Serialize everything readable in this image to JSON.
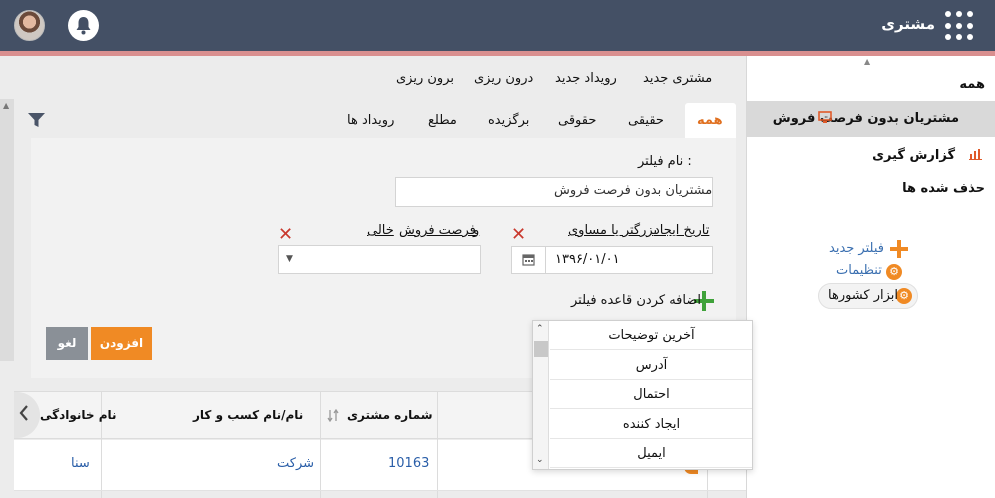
{
  "header": {
    "app_title": "مشتری"
  },
  "sidebar": {
    "items": {
      "all": "همه",
      "customers_no_opportunity": "مشتریان بدون فرصت فروش",
      "reporting": "گزارش گیری",
      "deleted": "حذف شده ها"
    },
    "links": {
      "new_filter": "فیلتر جدید",
      "settings": "تنظیمات",
      "country_tools": "ابزار کشورها"
    }
  },
  "top_menu": {
    "new_customer": "مشتری جدید",
    "new_event": "رویداد جدید",
    "import": "درون ریزی",
    "export": "برون ریزی"
  },
  "tabs": {
    "all": "همه",
    "legal": "حقیقی",
    "natural": "حقوقی",
    "selected": "برگزیده",
    "informed": "مطلع",
    "events": "رویداد ها"
  },
  "filter": {
    "name_label": "نام فیلتر :",
    "name_value": "مشتریان بدون فرصت فروش",
    "rule1": {
      "field": "تاریخ ایجاد",
      "operator": "بزرگتر یا مساوی",
      "value": "۱۳۹۶/۰۱/۰۱"
    },
    "connector": "و",
    "rule2": {
      "field": "فرصت فروش",
      "operator": "خالی",
      "value": ""
    },
    "add_rule": "اضافه کردن قاعده فیلتر",
    "add_button": "افزودن",
    "cancel_button": "لغو"
  },
  "dropdown_options": [
    "آخرین توضیحات",
    "آدرس",
    "احتمال",
    "ایجاد کننده",
    "ایمیل"
  ],
  "grid": {
    "headers": {
      "customer_number": "شماره مشتری",
      "business_name": "نام/نام کسب و کار",
      "family_name": "نام خانوادگی"
    },
    "rows": [
      {
        "customer_number": "10163",
        "business_name": "شرکت",
        "family_name": "سنا"
      }
    ]
  },
  "colors": {
    "topbar": "#445065",
    "accent_orange": "#f08a24",
    "add_green": "#3fa23a",
    "remove_red": "#c9382d",
    "link_blue": "#3a6fb0"
  }
}
